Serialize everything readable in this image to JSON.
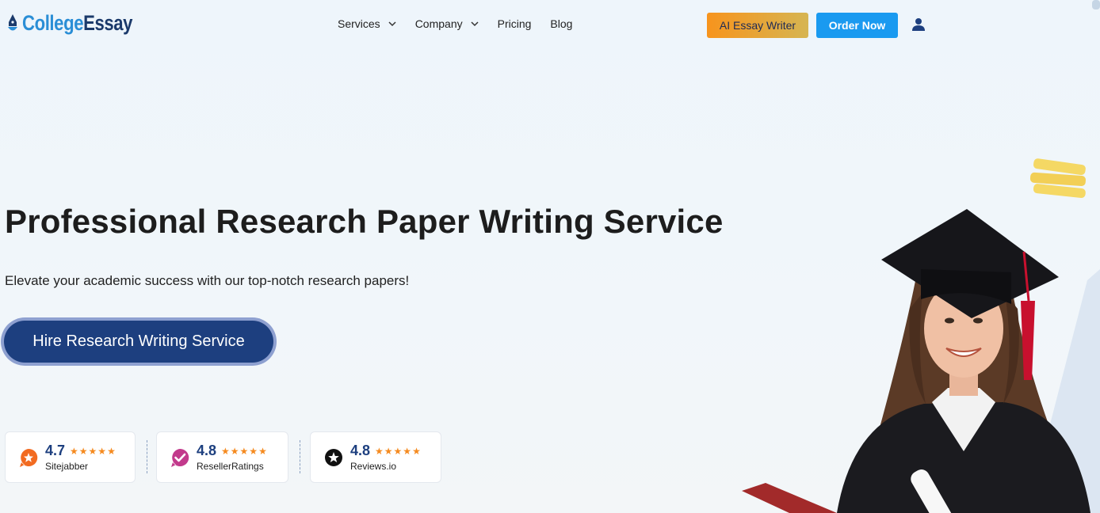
{
  "header": {
    "logo": {
      "part1": "College",
      "part2": "Essay"
    },
    "nav": [
      {
        "label": "Services",
        "has_dropdown": true
      },
      {
        "label": "Company",
        "has_dropdown": true
      },
      {
        "label": "Pricing",
        "has_dropdown": false
      },
      {
        "label": "Blog",
        "has_dropdown": false
      }
    ],
    "ai_button_label": "AI Essay Writer",
    "order_button_label": "Order Now",
    "user_icon": "user-icon"
  },
  "hero": {
    "title": "Professional Research Paper Writing Service",
    "subtitle": "Elevate your academic success with our top-notch research papers!",
    "cta_label": "Hire Research Writing Service"
  },
  "ratings": [
    {
      "score": "4.7",
      "stars": "★★★★★",
      "name": "Sitejabber",
      "icon": "sitejabber-icon",
      "color": "#f26b21"
    },
    {
      "score": "4.8",
      "stars": "★★★★★",
      "name": "ResellerRatings",
      "icon": "resellerratings-icon",
      "color": "#c23a8c"
    },
    {
      "score": "4.8",
      "stars": "★★★★★",
      "name": "Reviews.io",
      "icon": "reviews-io-icon",
      "color": "#111111"
    }
  ],
  "colors": {
    "primary_dark": "#1d3f7f",
    "order_blue": "#1a9af0",
    "ai_gradient_start": "#f7941d",
    "ai_gradient_end": "#d6b552",
    "star_orange": "#f58a1f"
  }
}
